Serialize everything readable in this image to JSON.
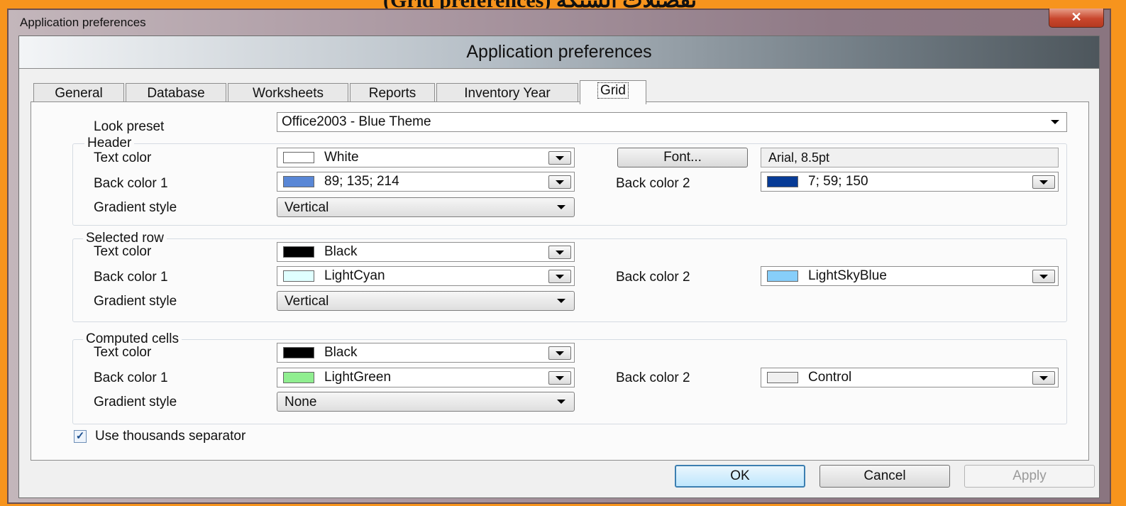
{
  "caption_overlay": "(Grid preferences) تفضيلات الشبكة",
  "window": {
    "title": "Application preferences",
    "close_glyph": "✕",
    "banner_title": "Application preferences"
  },
  "tabs": [
    "General",
    "Database",
    "Worksheets",
    "Reports",
    "Inventory Year",
    "Grid"
  ],
  "active_tab": "Grid",
  "look_preset": {
    "label": "Look preset",
    "value": "Office2003 - Blue Theme"
  },
  "header_group": {
    "title": "Header",
    "text_color_label": "Text color",
    "text_color": {
      "name": "White",
      "swatch": "#ffffff"
    },
    "back1_label": "Back color 1",
    "back1": {
      "name": "89; 135; 214",
      "swatch": "#5987d6"
    },
    "gradient_label": "Gradient style",
    "gradient": "Vertical",
    "font_button": "Font...",
    "font_value": "Arial, 8.5pt",
    "back2_label": "Back color 2",
    "back2": {
      "name": "7; 59; 150",
      "swatch": "#073b96"
    }
  },
  "selected_group": {
    "title": "Selected row",
    "text_color_label": "Text color",
    "text_color": {
      "name": "Black",
      "swatch": "#000000"
    },
    "back1_label": "Back color 1",
    "back1": {
      "name": "LightCyan",
      "swatch": "#e0ffff"
    },
    "gradient_label": "Gradient style",
    "gradient": "Vertical",
    "back2_label": "Back color 2",
    "back2": {
      "name": "LightSkyBlue",
      "swatch": "#87cefa"
    }
  },
  "computed_group": {
    "title": "Computed cells",
    "text_color_label": "Text color",
    "text_color": {
      "name": "Black",
      "swatch": "#000000"
    },
    "back1_label": "Back color 1",
    "back1": {
      "name": "LightGreen",
      "swatch": "#90ee90"
    },
    "gradient_label": "Gradient style",
    "gradient": "None",
    "back2_label": "Back color 2",
    "back2": {
      "name": "Control",
      "swatch": "#f0f0f0"
    }
  },
  "thousands": {
    "label": "Use thousands separator",
    "checked": true,
    "check_glyph": "✓"
  },
  "buttons": {
    "ok": "OK",
    "cancel": "Cancel",
    "apply": "Apply"
  }
}
